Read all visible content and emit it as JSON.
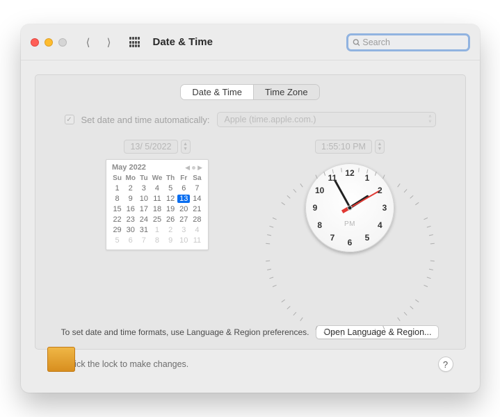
{
  "header": {
    "title": "Date & Time",
    "search_placeholder": "Search"
  },
  "tabs": {
    "date_time": "Date & Time",
    "time_zone": "Time Zone",
    "active": 0
  },
  "auto": {
    "label": "Set date and time automatically:",
    "server": "Apple (time.apple.com.)",
    "checked": true
  },
  "date": {
    "field": "13/ 5/2022",
    "month_label": "May 2022",
    "weekdays": [
      "Su",
      "Mo",
      "Tu",
      "We",
      "Th",
      "Fr",
      "Sa"
    ],
    "weeks": [
      [
        {
          "d": 1
        },
        {
          "d": 2
        },
        {
          "d": 3
        },
        {
          "d": 4
        },
        {
          "d": 5
        },
        {
          "d": 6
        },
        {
          "d": 7
        }
      ],
      [
        {
          "d": 8
        },
        {
          "d": 9
        },
        {
          "d": 10
        },
        {
          "d": 11
        },
        {
          "d": 12
        },
        {
          "d": 13,
          "sel": true
        },
        {
          "d": 14
        }
      ],
      [
        {
          "d": 15
        },
        {
          "d": 16
        },
        {
          "d": 17
        },
        {
          "d": 18
        },
        {
          "d": 19
        },
        {
          "d": 20
        },
        {
          "d": 21
        }
      ],
      [
        {
          "d": 22
        },
        {
          "d": 23
        },
        {
          "d": 24
        },
        {
          "d": 25
        },
        {
          "d": 26
        },
        {
          "d": 27
        },
        {
          "d": 28
        }
      ],
      [
        {
          "d": 29
        },
        {
          "d": 30
        },
        {
          "d": 31
        },
        {
          "d": 1,
          "dim": true
        },
        {
          "d": 2,
          "dim": true
        },
        {
          "d": 3,
          "dim": true
        },
        {
          "d": 4,
          "dim": true
        }
      ],
      [
        {
          "d": 5,
          "dim": true
        },
        {
          "d": 6,
          "dim": true
        },
        {
          "d": 7,
          "dim": true
        },
        {
          "d": 8,
          "dim": true
        },
        {
          "d": 9,
          "dim": true
        },
        {
          "d": 10,
          "dim": true
        },
        {
          "d": 11,
          "dim": true
        }
      ]
    ]
  },
  "time": {
    "field": "1:55:10 PM",
    "ampm": "PM",
    "hour_angle": 57.5,
    "minute_angle": 331,
    "second_angle": 60,
    "numerals": [
      "12",
      "1",
      "2",
      "3",
      "4",
      "5",
      "6",
      "7",
      "8",
      "9",
      "10",
      "11"
    ]
  },
  "format": {
    "text": "To set date and time formats, use Language & Region preferences.",
    "button": "Open Language & Region..."
  },
  "lock": {
    "text": "Click the lock to make changes."
  },
  "help": "?"
}
